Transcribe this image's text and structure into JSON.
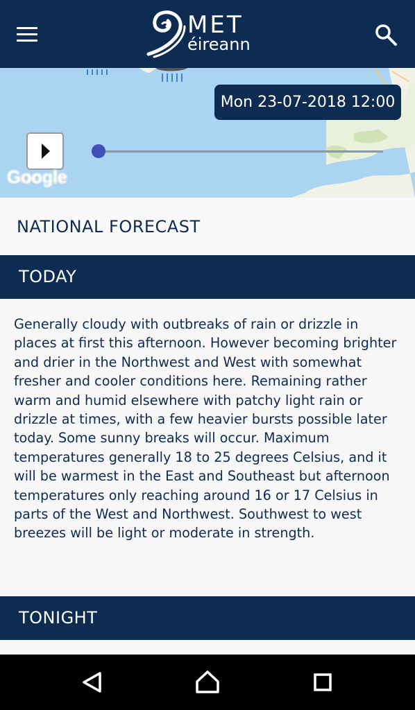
{
  "header": {
    "logo_line1": "MET",
    "logo_line2": "éireann"
  },
  "map": {
    "datetime": "Mon 23-07-2018 12:00",
    "attribution_logo_text": "Google",
    "timeline_progress": 0.0
  },
  "forecast": {
    "title": "NATIONAL FORECAST",
    "today_label": "TODAY",
    "today_text": "Generally cloudy with outbreaks of rain or drizzle in places at first this afternoon. However becoming brighter and drier in the Northwest and West with somewhat fresher and cooler conditions here. Remaining rather warm and humid elsewhere with patchy light rain or drizzle at times, with a few heavier bursts possible later today. Some sunny breaks will occur. Maximum temperatures generally 18 to 25 degrees Celsius, and it will be warmest in the East and Southeast but afternoon temperatures only reaching around 16 or 17 Celsius in parts of the West and Northwest. Southwest to west breezes will be light or moderate in strength.",
    "tonight_label": "TONIGHT"
  },
  "icons": {
    "menu": "hamburger-menu-icon",
    "search": "search-icon",
    "play": "play-icon",
    "back": "back-triangle-icon",
    "home": "home-icon",
    "recents": "recents-square-icon"
  },
  "colors": {
    "brand_navy": "#0e2b52",
    "map_water": "#abd3f2",
    "map_land": "#f1f2e7",
    "slider_thumb": "#3f51b5"
  }
}
